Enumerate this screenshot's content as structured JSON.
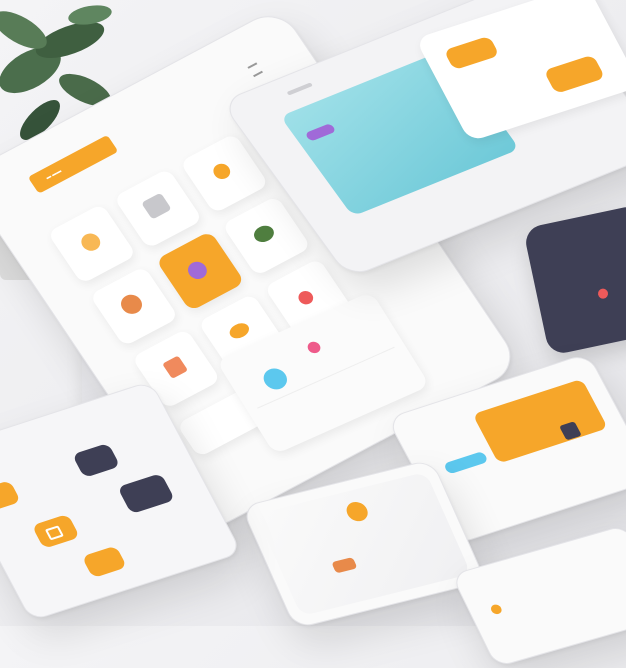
{
  "scene": {
    "colors": {
      "accent": "#f6a62a",
      "teal": "#7fd6e0",
      "purple": "#a06ad8",
      "dark": "#3e3f55",
      "blue": "#5cc8ee",
      "red": "#ee5a5a"
    },
    "icons": [
      "plant-icon",
      "shirt-icon",
      "wardrobe-icon",
      "pin-icon",
      "bag-icon",
      "camera-icon",
      "mail-icon",
      "map-pin-icon",
      "lock-icon",
      "chart-icon",
      "play-icon"
    ]
  }
}
